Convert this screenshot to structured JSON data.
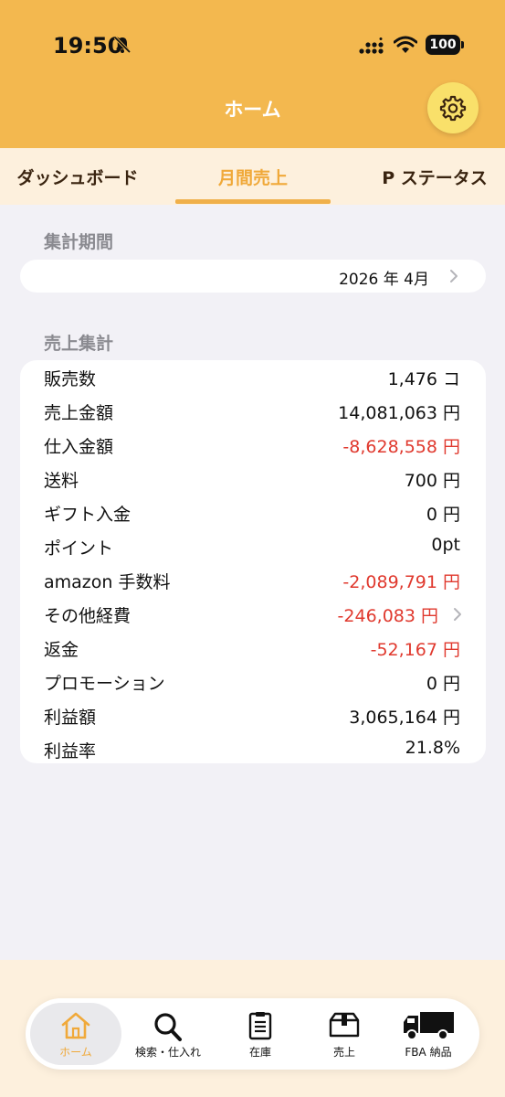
{
  "status_bar": {
    "time": "19:50",
    "battery": "100"
  },
  "nav": {
    "title": "ホーム"
  },
  "tabs": [
    {
      "label": "ダッシュボード"
    },
    {
      "label": "月間売上"
    },
    {
      "label": "P ステータス"
    }
  ],
  "period": {
    "header": "集計期間",
    "value": "2026 年 4月"
  },
  "summary": {
    "header": "売上集計",
    "rows": [
      {
        "label": "販売数",
        "value": "1,476 コ"
      },
      {
        "label": "売上金額",
        "value": "14,081,063 円"
      },
      {
        "label": "仕入金額",
        "value": "-8,628,558 円"
      },
      {
        "label": "送料",
        "value": "700 円"
      },
      {
        "label": "ギフト入金",
        "value": "0 円"
      },
      {
        "label": "ポイント",
        "value": "0pt"
      },
      {
        "label": "amazon 手数料",
        "value": "-2,089,791 円"
      },
      {
        "label": "その他経費",
        "value": "-246,083 円"
      },
      {
        "label": "返金",
        "value": "-52,167 円"
      },
      {
        "label": "プロモーション",
        "value": "0 円"
      },
      {
        "label": "利益額",
        "value": "3,065,164 円"
      },
      {
        "label": "利益率",
        "value": "21.8%"
      }
    ]
  },
  "tabbar": [
    {
      "label": "ホーム"
    },
    {
      "label": "検索・仕入れ"
    },
    {
      "label": "在庫"
    },
    {
      "label": "売上"
    },
    {
      "label": "FBA 納品"
    }
  ],
  "colors": {
    "accent": "#f3b84f",
    "negative": "#e0392e",
    "settings_button": "#f9e06a"
  }
}
